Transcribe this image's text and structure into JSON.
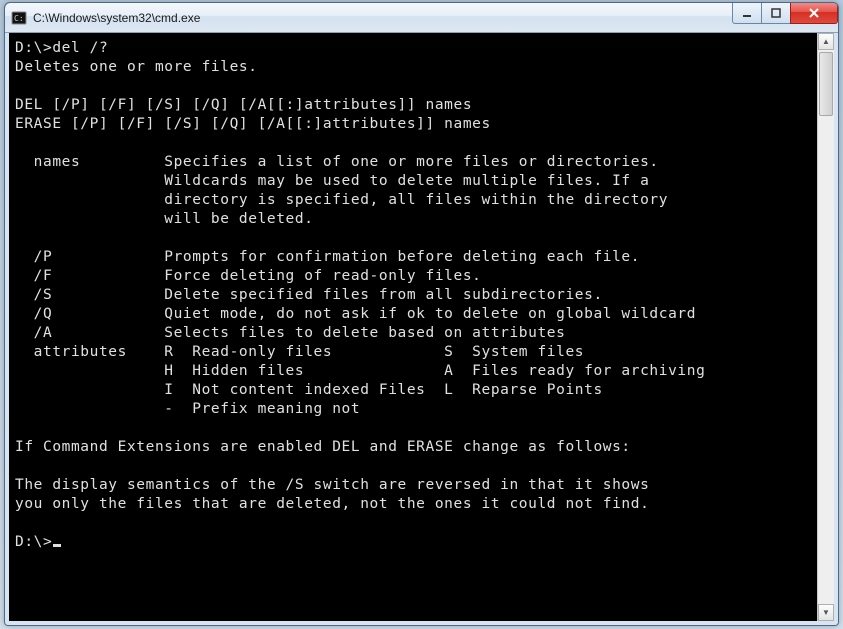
{
  "window": {
    "title": "C:\\Windows\\system32\\cmd.exe"
  },
  "console": {
    "prompt1": "D:\\>",
    "cmd1": "del /?",
    "out": [
      "Deletes one or more files.",
      "",
      "DEL [/P] [/F] [/S] [/Q] [/A[[:]attributes]] names",
      "ERASE [/P] [/F] [/S] [/Q] [/A[[:]attributes]] names",
      "",
      "  names         Specifies a list of one or more files or directories.",
      "                Wildcards may be used to delete multiple files. If a",
      "                directory is specified, all files within the directory",
      "                will be deleted.",
      "",
      "  /P            Prompts for confirmation before deleting each file.",
      "  /F            Force deleting of read-only files.",
      "  /S            Delete specified files from all subdirectories.",
      "  /Q            Quiet mode, do not ask if ok to delete on global wildcard",
      "  /A            Selects files to delete based on attributes",
      "  attributes    R  Read-only files            S  System files",
      "                H  Hidden files               A  Files ready for archiving",
      "                I  Not content indexed Files  L  Reparse Points",
      "                -  Prefix meaning not",
      "",
      "If Command Extensions are enabled DEL and ERASE change as follows:",
      "",
      "The display semantics of the /S switch are reversed in that it shows",
      "you only the files that are deleted, not the ones it could not find.",
      ""
    ],
    "prompt2": "D:\\>"
  }
}
